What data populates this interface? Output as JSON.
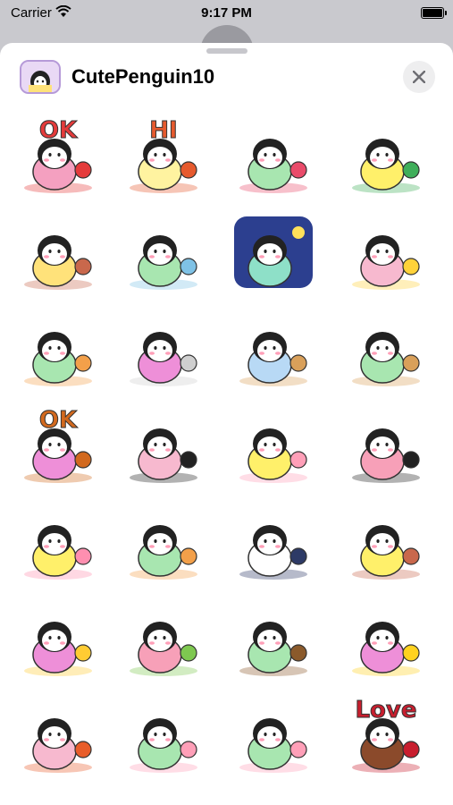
{
  "status_bar": {
    "carrier": "Carrier",
    "time": "9:17 PM"
  },
  "header": {
    "title": "CutePenguin10",
    "close_icon": "close-icon"
  },
  "stickers": [
    {
      "name": "ok-sign",
      "text": "OK",
      "bg": "",
      "accent": "#e43b3b",
      "body": "#f4a0c0"
    },
    {
      "name": "hi-sign",
      "text": "HI",
      "bg": "",
      "accent": "#e65a2e",
      "body": "#fff3a0"
    },
    {
      "name": "gift-hearts",
      "text": "",
      "bg": "",
      "accent": "#e94b6a",
      "body": "#a8e6b0"
    },
    {
      "name": "bicycle",
      "text": "",
      "bg": "",
      "accent": "#3fae5a",
      "body": "#fff06a"
    },
    {
      "name": "sleeping-bed",
      "text": "",
      "bg": "",
      "accent": "#c9684c",
      "body": "#ffe27a"
    },
    {
      "name": "sleepy-pillow",
      "text": "",
      "bg": "",
      "accent": "#7fc2e6",
      "body": "#a8e6b0"
    },
    {
      "name": "night-moon",
      "text": "",
      "bg": "#2c3f8f",
      "accent": "#ffe15a",
      "body": "#8ee0c8"
    },
    {
      "name": "glowing-seal",
      "text": "",
      "bg": "",
      "accent": "#ffd23a",
      "body": "#f7b9cf"
    },
    {
      "name": "sunny-scarf",
      "text": "",
      "bg": "",
      "accent": "#f3a04a",
      "body": "#a8e6b0"
    },
    {
      "name": "seal-friend",
      "text": "",
      "bg": "",
      "accent": "#cfcfcf",
      "body": "#ee8fd8"
    },
    {
      "name": "basket-sheep",
      "text": "",
      "bg": "",
      "accent": "#d9a05a",
      "body": "#b8d9f5"
    },
    {
      "name": "box-peek",
      "text": "",
      "bg": "",
      "accent": "#d9a05a",
      "body": "#a8e6b0"
    },
    {
      "name": "ok-board",
      "text": "OK",
      "bg": "",
      "accent": "#d2691e",
      "body": "#ee8fd8"
    },
    {
      "name": "big-penguin",
      "text": "",
      "bg": "",
      "accent": "#222222",
      "body": "#f7b9cf"
    },
    {
      "name": "flowers-tea",
      "text": "",
      "bg": "",
      "accent": "#ff9fb8",
      "body": "#fff06a"
    },
    {
      "name": "pink-hug",
      "text": "",
      "bg": "",
      "accent": "#222222",
      "body": "#f7a0b8"
    },
    {
      "name": "candy-seal",
      "text": "",
      "bg": "",
      "accent": "#ff8fb0",
      "body": "#fff06a"
    },
    {
      "name": "cup-hold",
      "text": "",
      "bg": "",
      "accent": "#f3a04a",
      "body": "#a8e6b0"
    },
    {
      "name": "suit-broom",
      "text": "",
      "bg": "",
      "accent": "#2d3a66",
      "body": "#ffffff"
    },
    {
      "name": "tea-time",
      "text": "",
      "bg": "",
      "accent": "#c9684c",
      "body": "#fff06a"
    },
    {
      "name": "bath-chick",
      "text": "",
      "bg": "",
      "accent": "#ffcc33",
      "body": "#ee8fd8"
    },
    {
      "name": "picnic-bee",
      "text": "",
      "bg": "",
      "accent": "#7ec850",
      "body": "#f7a0b8"
    },
    {
      "name": "window",
      "text": "",
      "bg": "",
      "accent": "#8b5a2b",
      "body": "#a8e6b0"
    },
    {
      "name": "umbrella",
      "text": "",
      "bg": "",
      "accent": "#ffd21f",
      "body": "#ee8fd8"
    },
    {
      "name": "fireplace",
      "text": "",
      "bg": "",
      "accent": "#e85d2a",
      "body": "#f7b9cf"
    },
    {
      "name": "bouquet",
      "text": "",
      "bg": "",
      "accent": "#ff9fb8",
      "body": "#a8e6b0"
    },
    {
      "name": "cake",
      "text": "",
      "bg": "",
      "accent": "#ff9fb8",
      "body": "#a8e6b0"
    },
    {
      "name": "chocolate-love",
      "text": "Love",
      "bg": "",
      "accent": "#c81e2e",
      "body": "#8b4a2b"
    }
  ]
}
